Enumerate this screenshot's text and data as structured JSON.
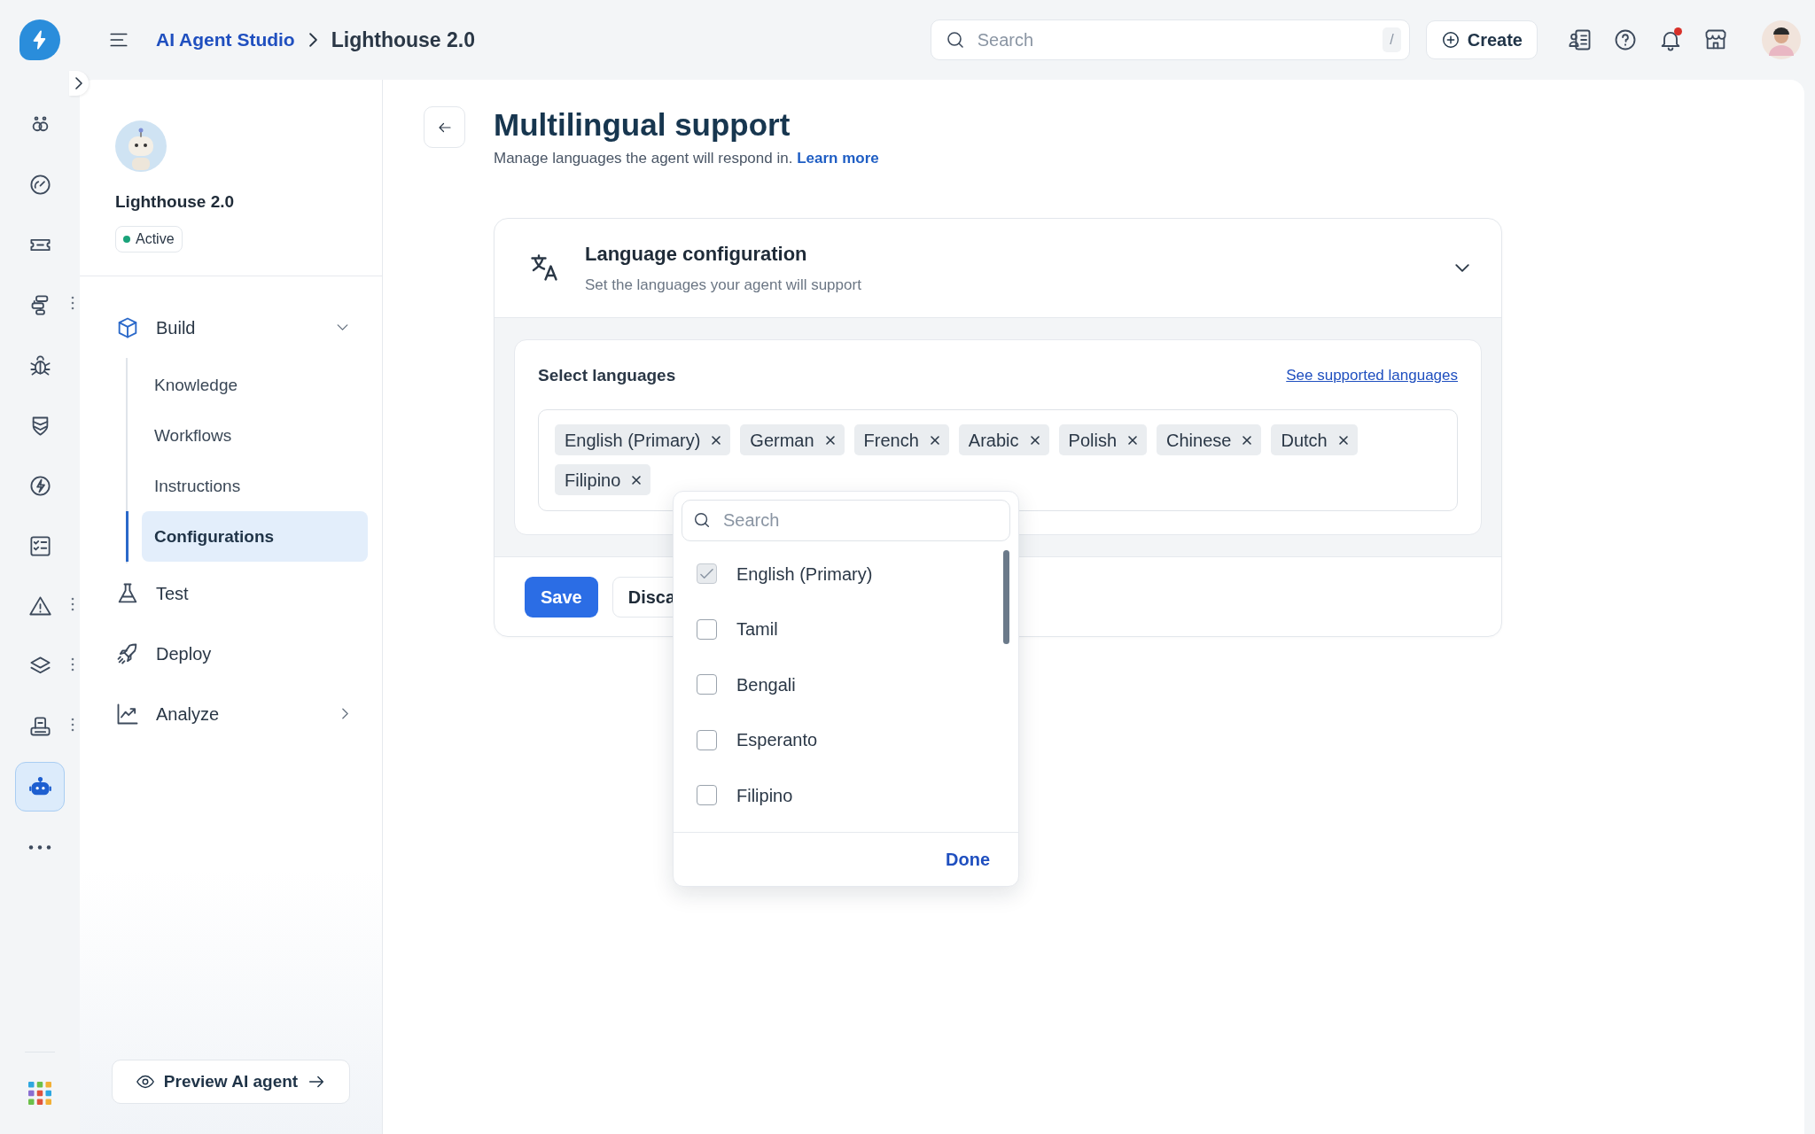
{
  "top_bar": {
    "breadcrumb": [
      {
        "label": "AI Agent Studio",
        "kind": "link"
      },
      {
        "label": "Lighthouse 2.0",
        "kind": "current"
      }
    ],
    "search": {
      "placeholder": "Search",
      "shortcut": "/"
    },
    "create_button": "Create",
    "notifications_unread": true
  },
  "rail": {
    "items": [
      {
        "selected": false,
        "menu": false
      },
      {
        "selected": false,
        "menu": false
      },
      {
        "selected": false,
        "menu": false
      },
      {
        "selected": false,
        "menu": true
      },
      {
        "selected": false,
        "menu": false
      },
      {
        "selected": false,
        "menu": false
      },
      {
        "selected": false,
        "menu": false
      },
      {
        "selected": false,
        "menu": false
      },
      {
        "selected": false,
        "menu": true
      },
      {
        "selected": false,
        "menu": true
      },
      {
        "selected": false,
        "menu": true
      },
      {
        "selected": true,
        "menu": false
      }
    ]
  },
  "sidebar": {
    "agent_name": "Lighthouse 2.0",
    "status": "Active",
    "nav": [
      {
        "label": "Build",
        "expanded": true,
        "children": [
          {
            "label": "Knowledge",
            "selected": false
          },
          {
            "label": "Workflows",
            "selected": false
          },
          {
            "label": "Instructions",
            "selected": false
          },
          {
            "label": "Configurations",
            "selected": true
          }
        ]
      },
      {
        "label": "Test"
      },
      {
        "label": "Deploy"
      },
      {
        "label": "Analyze",
        "expanded": false
      }
    ],
    "preview_button": "Preview AI agent"
  },
  "page": {
    "title": "Multilingual support",
    "subtitle": "Manage languages the agent will respond in.",
    "learn_more": "Learn more"
  },
  "language_card": {
    "title": "Language configuration",
    "subtitle": "Set the languages your agent will support",
    "expanded": true,
    "select_label": "Select languages",
    "supported_link": "See supported languages",
    "tags": [
      "English (Primary)",
      "German",
      "French",
      "Arabic",
      "Polish",
      "Chinese",
      "Dutch",
      "Filipino"
    ],
    "save_button": "Save",
    "discard_button": "Disca"
  },
  "dropdown": {
    "search_placeholder": "Search",
    "options": [
      {
        "label": "English (Primary)",
        "checked": true,
        "disabled": true
      },
      {
        "label": "Tamil",
        "checked": false,
        "disabled": false
      },
      {
        "label": "Bengali",
        "checked": false,
        "disabled": false
      },
      {
        "label": "Esperanto",
        "checked": false,
        "disabled": false
      },
      {
        "label": "Filipino",
        "checked": false,
        "disabled": false
      }
    ],
    "done_button": "Done"
  }
}
